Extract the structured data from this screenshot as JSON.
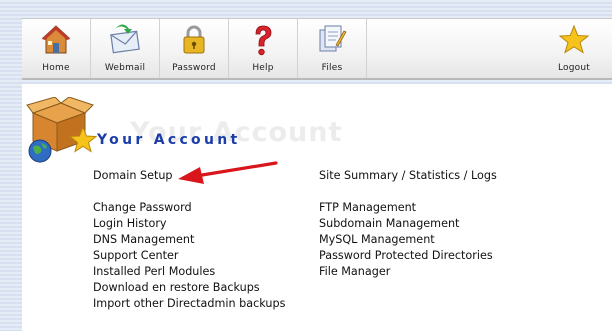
{
  "toolbar": {
    "items": [
      {
        "label": "Home",
        "icon": "house-icon"
      },
      {
        "label": "Webmail",
        "icon": "mail-icon"
      },
      {
        "label": "Password",
        "icon": "padlock-icon"
      },
      {
        "label": "Help",
        "icon": "question-mark-icon"
      },
      {
        "label": "Files",
        "icon": "files-icon"
      }
    ],
    "logout": {
      "label": "Logout",
      "icon": "star-icon"
    }
  },
  "section": {
    "title": "Your Account",
    "watermark": "Your Account"
  },
  "links": {
    "left": [
      "Domain Setup",
      "Change Password",
      "Login History",
      "DNS Management",
      "Support Center",
      "Installed Perl Modules",
      "Download en restore Backups",
      "Import other Directadmin backups"
    ],
    "right": [
      "Site Summary / Statistics / Logs",
      "FTP Management",
      "Subdomain Management",
      "MySQL Management",
      "Password Protected Directories",
      "File Manager"
    ]
  },
  "colors": {
    "title": "#1a3da8",
    "arrow": "#d8161b",
    "background_stripes": "#d7e0ee"
  }
}
